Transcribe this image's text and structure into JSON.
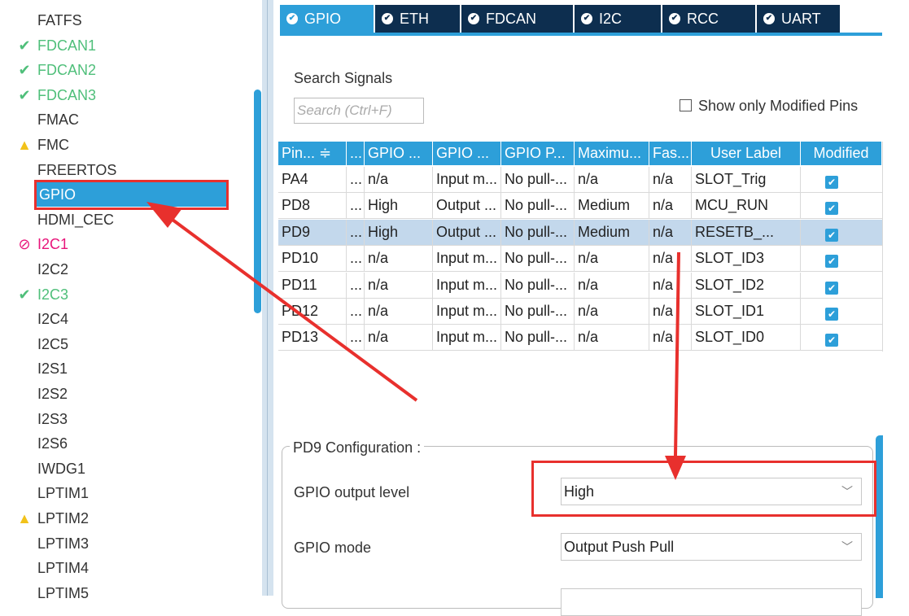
{
  "sidebar": {
    "items": [
      {
        "label": "FATFS",
        "status": "none",
        "icon": ""
      },
      {
        "label": "FDCAN1",
        "status": "ok",
        "icon": "✔"
      },
      {
        "label": "FDCAN2",
        "status": "ok",
        "icon": "✔"
      },
      {
        "label": "FDCAN3",
        "status": "ok",
        "icon": "✔"
      },
      {
        "label": "FMAC",
        "status": "none",
        "icon": ""
      },
      {
        "label": "FMC",
        "status": "warn",
        "icon": "▲"
      },
      {
        "label": "FREERTOS",
        "status": "none",
        "icon": ""
      },
      {
        "label": "GPIO",
        "status": "selected",
        "icon": ""
      },
      {
        "label": "HDMI_CEC",
        "status": "none",
        "icon": ""
      },
      {
        "label": "I2C1",
        "status": "err",
        "icon": "⊘"
      },
      {
        "label": "I2C2",
        "status": "none",
        "icon": ""
      },
      {
        "label": "I2C3",
        "status": "ok",
        "icon": "✔"
      },
      {
        "label": "I2C4",
        "status": "none",
        "icon": ""
      },
      {
        "label": "I2C5",
        "status": "none",
        "icon": ""
      },
      {
        "label": "I2S1",
        "status": "none",
        "icon": ""
      },
      {
        "label": "I2S2",
        "status": "none",
        "icon": ""
      },
      {
        "label": "I2S3",
        "status": "none",
        "icon": ""
      },
      {
        "label": "I2S6",
        "status": "none",
        "icon": ""
      },
      {
        "label": "IWDG1",
        "status": "none",
        "icon": ""
      },
      {
        "label": "LPTIM1",
        "status": "none",
        "icon": ""
      },
      {
        "label": "LPTIM2",
        "status": "warn",
        "icon": "▲"
      },
      {
        "label": "LPTIM3",
        "status": "none",
        "icon": ""
      },
      {
        "label": "LPTIM4",
        "status": "none",
        "icon": ""
      },
      {
        "label": "LPTIM5",
        "status": "none",
        "icon": ""
      }
    ]
  },
  "tabs": [
    {
      "label": "GPIO",
      "active": true
    },
    {
      "label": "ETH",
      "active": false
    },
    {
      "label": "FDCAN",
      "active": false
    },
    {
      "label": "I2C",
      "active": false
    },
    {
      "label": "RCC",
      "active": false
    },
    {
      "label": "UART",
      "active": false
    }
  ],
  "search": {
    "title": "Search Signals",
    "placeholder": "Search (Ctrl+F)",
    "show_modified_label": "Show only Modified Pins",
    "show_modified_checked": false
  },
  "table": {
    "columns": [
      "Pin... ≑",
      "...",
      "GPIO ...",
      "GPIO ...",
      "GPIO P...",
      "Maximu...",
      "Fas...",
      "User Label",
      "Modified"
    ],
    "rows": [
      {
        "cells": [
          "PA4",
          "...",
          "n/a",
          "Input m...",
          "No pull-...",
          "n/a",
          "n/a",
          "SLOT_Trig"
        ],
        "modified": true,
        "selected": false
      },
      {
        "cells": [
          "PD8",
          "...",
          "High",
          "Output ...",
          "No pull-...",
          "Medium",
          "n/a",
          "MCU_RUN"
        ],
        "modified": true,
        "selected": false
      },
      {
        "cells": [
          "PD9",
          "...",
          "High",
          "Output ...",
          "No pull-...",
          "Medium",
          "n/a",
          "RESETB_..."
        ],
        "modified": true,
        "selected": true
      },
      {
        "cells": [
          "PD10",
          "...",
          "n/a",
          "Input m...",
          "No pull-...",
          "n/a",
          "n/a",
          "SLOT_ID3"
        ],
        "modified": true,
        "selected": false
      },
      {
        "cells": [
          "PD11",
          "...",
          "n/a",
          "Input m...",
          "No pull-...",
          "n/a",
          "n/a",
          "SLOT_ID2"
        ],
        "modified": true,
        "selected": false
      },
      {
        "cells": [
          "PD12",
          "...",
          "n/a",
          "Input m...",
          "No pull-...",
          "n/a",
          "n/a",
          "SLOT_ID1"
        ],
        "modified": true,
        "selected": false
      },
      {
        "cells": [
          "PD13",
          "...",
          "n/a",
          "Input m...",
          "No pull-...",
          "n/a",
          "n/a",
          "SLOT_ID0"
        ],
        "modified": true,
        "selected": false
      }
    ]
  },
  "config": {
    "title": "PD9 Configuration :",
    "fields": [
      {
        "label": "GPIO output level",
        "value": "High"
      },
      {
        "label": "GPIO mode",
        "value": "Output Push Pull"
      },
      {
        "label": "",
        "value": ""
      }
    ]
  },
  "colors": {
    "accent": "#2d9fd9",
    "tab_dark": "#0d2e4f",
    "ok_green": "#4fbf7a",
    "error_pink": "#e8157a",
    "warning_yellow": "#f2c21a",
    "annotation_red": "#e8302d"
  }
}
